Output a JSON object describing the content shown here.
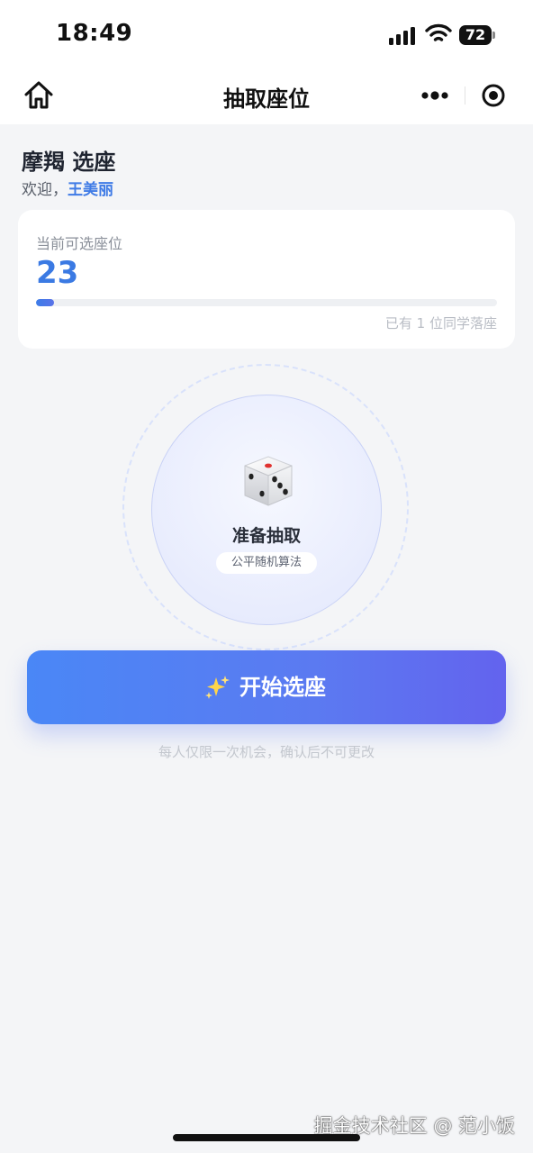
{
  "status_bar": {
    "time": "18:49",
    "battery": "72"
  },
  "nav": {
    "title": "抽取座位",
    "home_icon": "home-icon",
    "more_icon": "more-dots-icon",
    "target_icon": "target-icon"
  },
  "header": {
    "title": "摩羯 选座",
    "welcome_prefix": "欢迎，",
    "user_name": "王美丽"
  },
  "stats": {
    "label": "当前可选座位",
    "count": "23",
    "progress": 0.04,
    "note": "已有 1 位同学落座"
  },
  "draw": {
    "icon": "dice-icon",
    "title": "准备抽取",
    "subtitle": "公平随机算法"
  },
  "action": {
    "start_icon": "sparkles-icon",
    "start_label": "开始选座",
    "hint": "每人仅限一次机会，确认后不可更改"
  },
  "watermark": "掘金技术社区 @ 范小饭",
  "colors": {
    "accent": "#3b7ae3",
    "button_start": "#4a87f6",
    "button_end": "#6363ee",
    "background": "#f4f5f7"
  }
}
